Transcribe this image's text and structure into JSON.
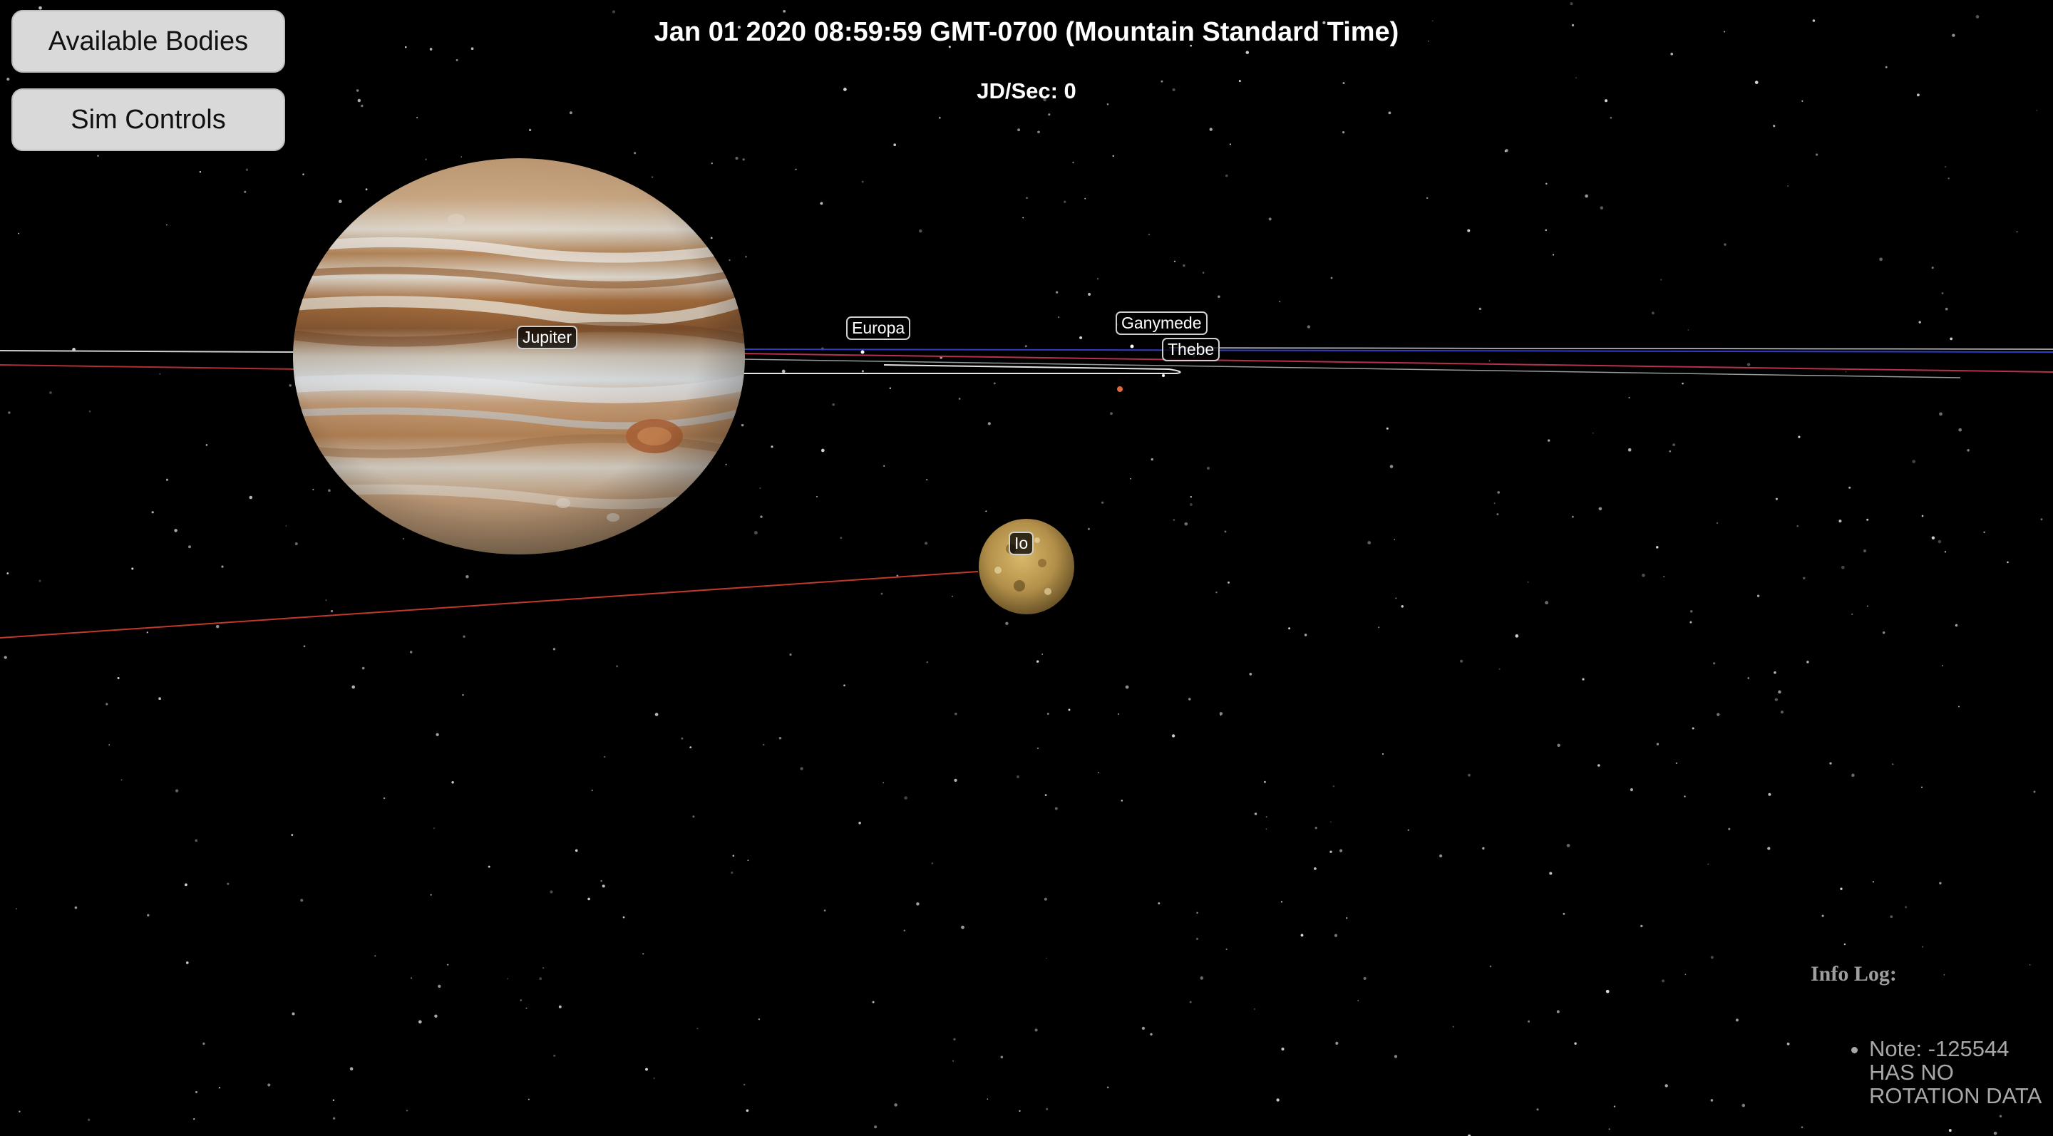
{
  "menu": {
    "available_bodies": "Available Bodies",
    "sim_controls": "Sim Controls"
  },
  "header": {
    "datetime": "Jan 01 2020 08:59:59 GMT-0700 (Mountain Standard Time)",
    "rate": "JD/Sec: 0"
  },
  "labels": {
    "jupiter": "Jupiter",
    "europa": "Europa",
    "ganymede": "Ganymede",
    "thebe": "Thebe",
    "io": "Io"
  },
  "info_log": {
    "title": "Info Log:",
    "entries": [
      "Note: -125544 HAS NO ROTATION DATA"
    ]
  },
  "colors": {
    "background": "#000000",
    "orbit_red": "#c0392b",
    "orbit_blue": "#2e3cc8",
    "orbit_white": "#e6e6e6"
  }
}
